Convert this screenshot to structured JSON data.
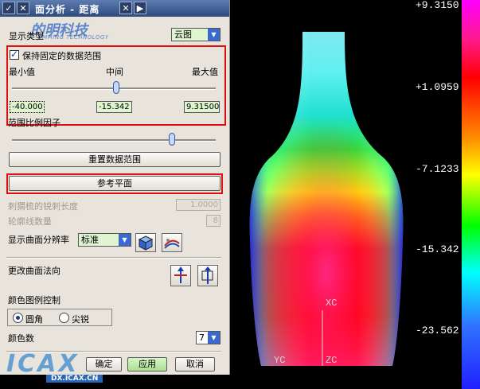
{
  "dialog": {
    "title": "面分析 - 距离",
    "display_type_label": "显示类型",
    "display_type_value": "云图",
    "keep_range_label": "保持固定的数据范围",
    "keep_range_checked": true,
    "min_label": "最小值",
    "mid_label": "中间",
    "max_label": "最大值",
    "min_value": "-40.000",
    "mid_value": "-15.342",
    "max_value": "9.31500",
    "scale_factor_label": "范围比例因子",
    "reset_range_button": "重置数据范围",
    "ref_plane_button": "参考平面",
    "spike_length_label": "刺猬梳的锐刺长度",
    "spike_length_value": "1.0000",
    "contour_count_label": "轮廓线数量",
    "contour_count_value": "8",
    "resolution_label": "显示曲面分辨率",
    "resolution_value": "标准",
    "change_normal_label": "更改曲面法向",
    "legend_control_label": "颜色图例控制",
    "radio_round": "圆角",
    "radio_sharp": "尖锐",
    "color_count_label": "颜色数",
    "color_count_value": "7",
    "ok_button": "确定",
    "apply_button": "应用",
    "cancel_button": "取消"
  },
  "watermarks": {
    "top_brand": "的明科技",
    "top_brand_sub": "JIMMING TECHNOLOGY",
    "bottom_brand": "ICAX",
    "bottom_brand_sub": "DX.ICAX.CN"
  },
  "legend": {
    "values": [
      "+9.3150",
      "+1.0959",
      "-7.1233",
      "-15.342",
      "-23.562"
    ]
  },
  "viewport": {
    "axis_xc": "XC",
    "axis_zc": "ZC",
    "axis_yc": "YC"
  },
  "colors": {
    "highlight_red": "#e01010",
    "title_bar": "#3b5a90",
    "field_green": "#dff5d0"
  }
}
